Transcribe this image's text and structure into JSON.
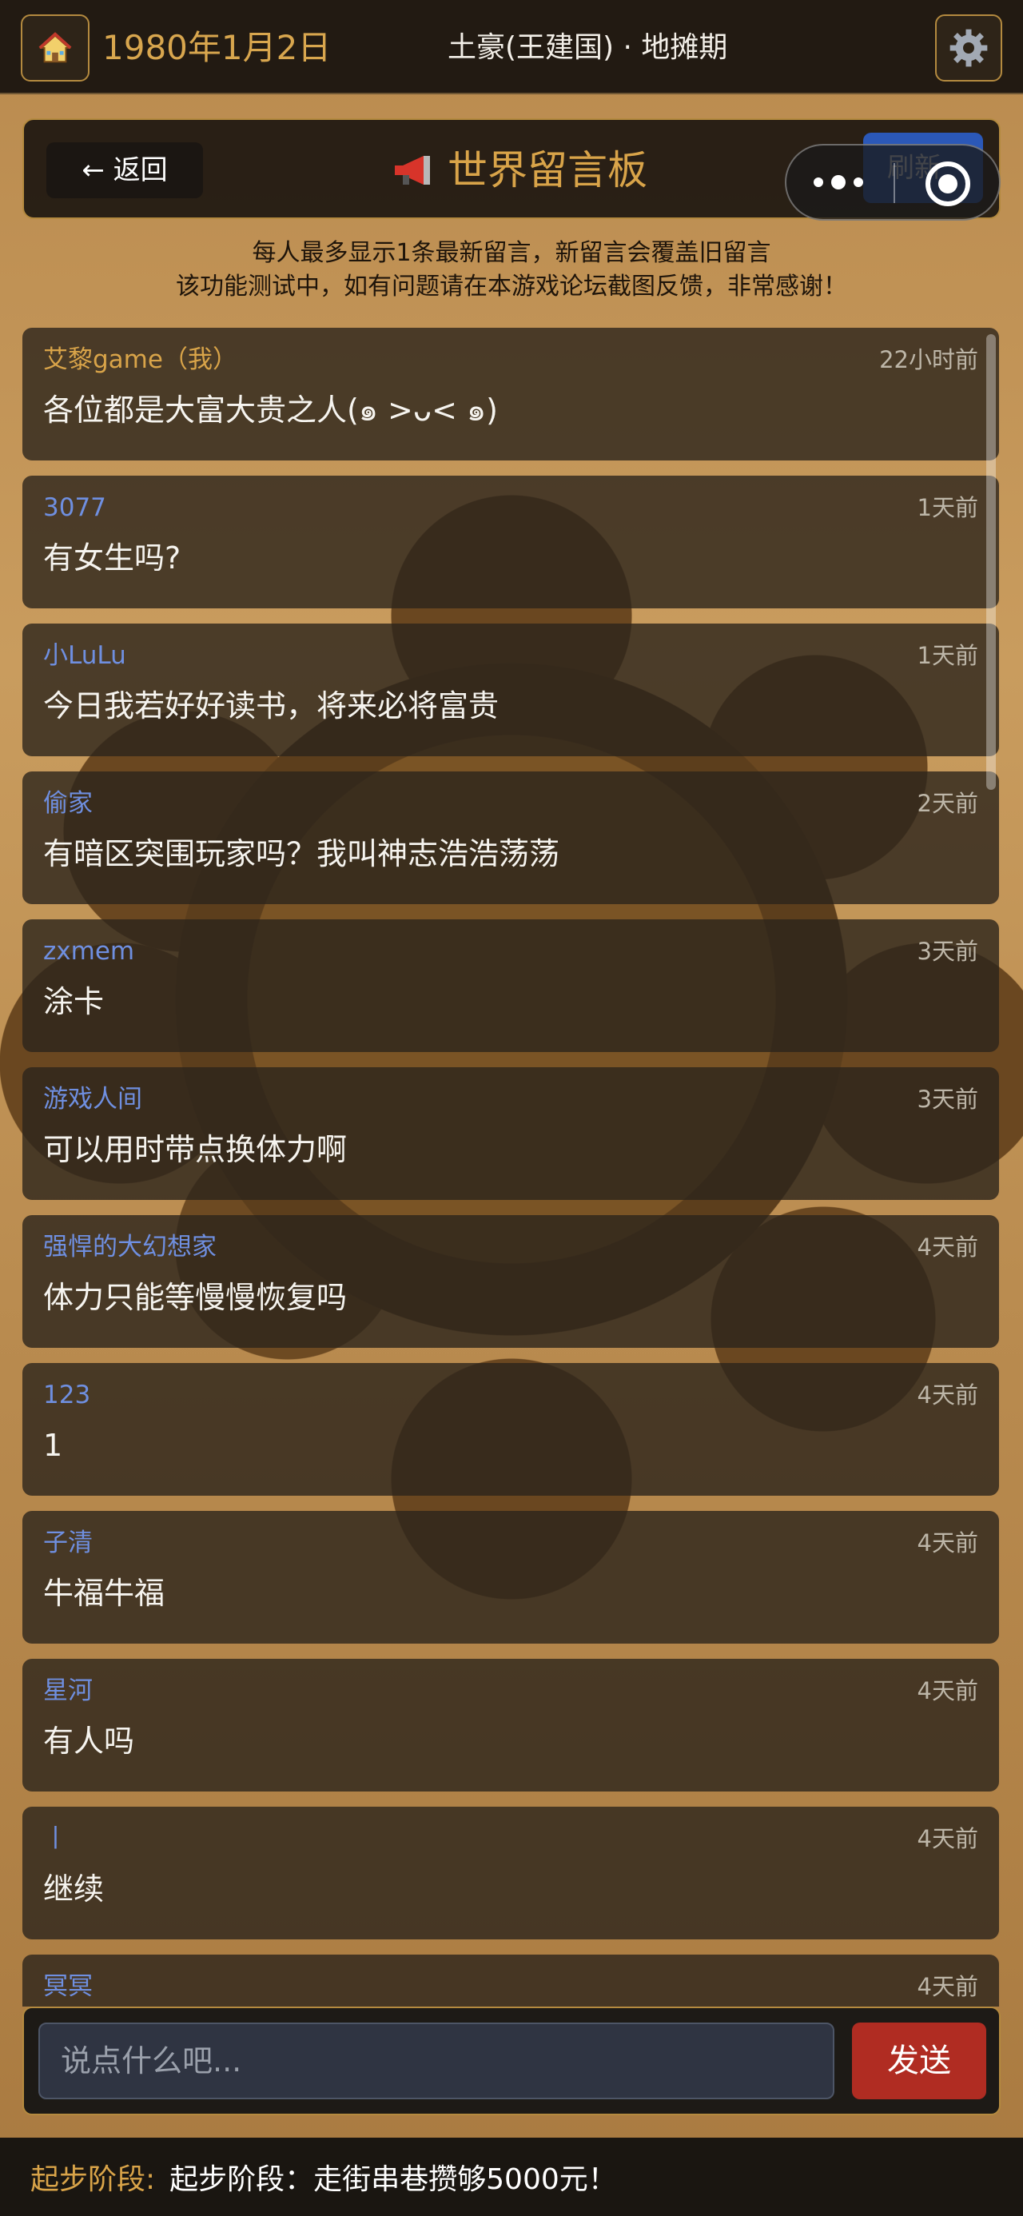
{
  "topbar": {
    "date": "1980年1月2日",
    "player": "土豪(王建国) · 地摊期",
    "home_icon": "house-icon",
    "settings_icon": "gear-icon"
  },
  "board": {
    "back_label": "← 返回",
    "title": "世界留言板",
    "title_icon": "megaphone-icon",
    "refresh_label": "刷新",
    "notice_line1": "每人最多显示1条最新留言，新留言会覆盖旧留言",
    "notice_line2": "该功能测试中，如有问题请在本游戏论坛截图反馈，非常感谢！"
  },
  "messages": [
    {
      "name": "艾黎game（我）",
      "time": "22小时前",
      "text": "各位都是大富大贵之人(๑ >ᴗ< ๑)",
      "self": true
    },
    {
      "name": "3077",
      "time": "1天前",
      "text": "有女生吗?"
    },
    {
      "name": "小LuLu",
      "time": "1天前",
      "text": "今日我若好好读书，将来必将富贵"
    },
    {
      "name": "偷家",
      "time": "2天前",
      "text": "有暗区突围玩家吗？我叫神志浩浩荡荡"
    },
    {
      "name": "zxmem",
      "time": "3天前",
      "text": "涂卡"
    },
    {
      "name": "游戏人间",
      "time": "3天前",
      "text": "可以用时带点换体力啊"
    },
    {
      "name": "强悍的大幻想家",
      "time": "4天前",
      "text": "体力只能等慢慢恢复吗"
    },
    {
      "name": "123",
      "time": "4天前",
      "text": "1"
    },
    {
      "name": "子清",
      "time": "4天前",
      "text": "牛福牛福"
    },
    {
      "name": "星河",
      "time": "4天前",
      "text": "有人吗"
    },
    {
      "name": "丨",
      "time": "4天前",
      "text": "继续"
    },
    {
      "name": "冥冥",
      "time": "4天前",
      "text": ""
    }
  ],
  "composer": {
    "placeholder": "说点什么吧...",
    "send_label": "发送"
  },
  "status": {
    "stage_label": "起步阶段:",
    "stage_text": "起步阶段：走街串巷攒够5000元！"
  },
  "colors": {
    "gold": "#d9a449",
    "username_blue": "#6f8fe0",
    "send_red": "#b02c22",
    "refresh_blue": "#2b58b8"
  }
}
